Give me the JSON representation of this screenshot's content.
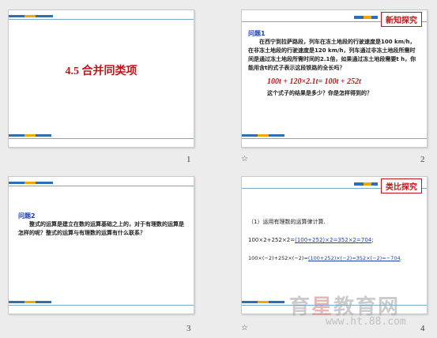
{
  "slides": [
    {
      "number": "1",
      "title": "4.5  合并同类项"
    },
    {
      "number": "2",
      "badge": "新知探究",
      "label": "问题1",
      "text": "　　在西宁到拉萨路段，列车在冻土地段的行驶速度是100 km/h，在非冻土地段的行驶速度是120 km/h，列车通过非冻土地段所需时间是通过冻土地段所需时间的2.1倍，如果通过冻土地段需要t h，你能用含t的式子表示这段铁路的全长吗？",
      "equation": "100t + 120×2.1t= 100t + 252t",
      "question": "这个式子的结果是多少？你是怎样得到的？"
    },
    {
      "number": "3",
      "label": "问题2",
      "text": "　　整式的运算是建立在数的运算基础之上的，对于有理数的运算是怎样的呢？整式的运算与有理数的运算有什么联系？"
    },
    {
      "number": "4",
      "badge": "类比探究",
      "line1": "（1）运用有理数的运算律计算.",
      "line2_pre": "100×2+252×2=",
      "line2_ans": "(100+252)×2=352×2=704",
      "line2_post": ";",
      "line3_pre": "100×(−2)+252×(−2)=",
      "line3_ans": "(100+252)×(−2)=352×(−2)=−704",
      "line3_post": "."
    }
  ],
  "watermark": {
    "text_a": "育",
    "text_b": "星",
    "text_c": "教育网",
    "url": "www.ht.88.com"
  },
  "colors": {
    "accent_red": "#c0141b",
    "accent_blue": "#1a3fb5",
    "bar_orange": "#f0a800",
    "bar_blue": "#2d6fb0"
  }
}
